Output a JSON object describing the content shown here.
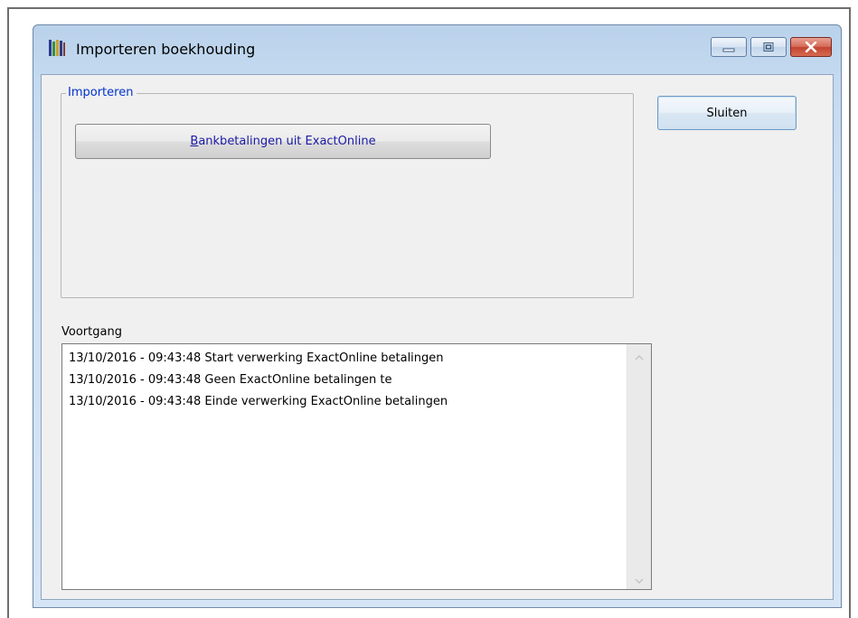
{
  "window": {
    "title": "Importeren boekhouding"
  },
  "import_group": {
    "legend": "Importeren",
    "button_access_key": "B",
    "button_label_rest": "ankbetalingen uit  ExactOnline"
  },
  "close_button": {
    "label": "Sluiten"
  },
  "progress": {
    "label": "Voortgang",
    "log_lines": [
      "13/10/2016 - 09:43:48 Start verwerking ExactOnline betalingen",
      "13/10/2016 - 09:43:48 Geen ExactOnline betalingen te",
      "13/10/2016 - 09:43:48 Einde verwerking ExactOnline betalingen"
    ]
  },
  "colors": {
    "legend_text": "#0033cc",
    "import_button_text": "#1a1aa6",
    "close_caption_button": "#c24330"
  },
  "icons": {
    "app": "books-icon",
    "minimize": "minimize-icon",
    "maximize": "maximize-icon",
    "close": "close-icon",
    "scroll_up": "chevron-up-icon",
    "scroll_down": "chevron-down-icon"
  }
}
